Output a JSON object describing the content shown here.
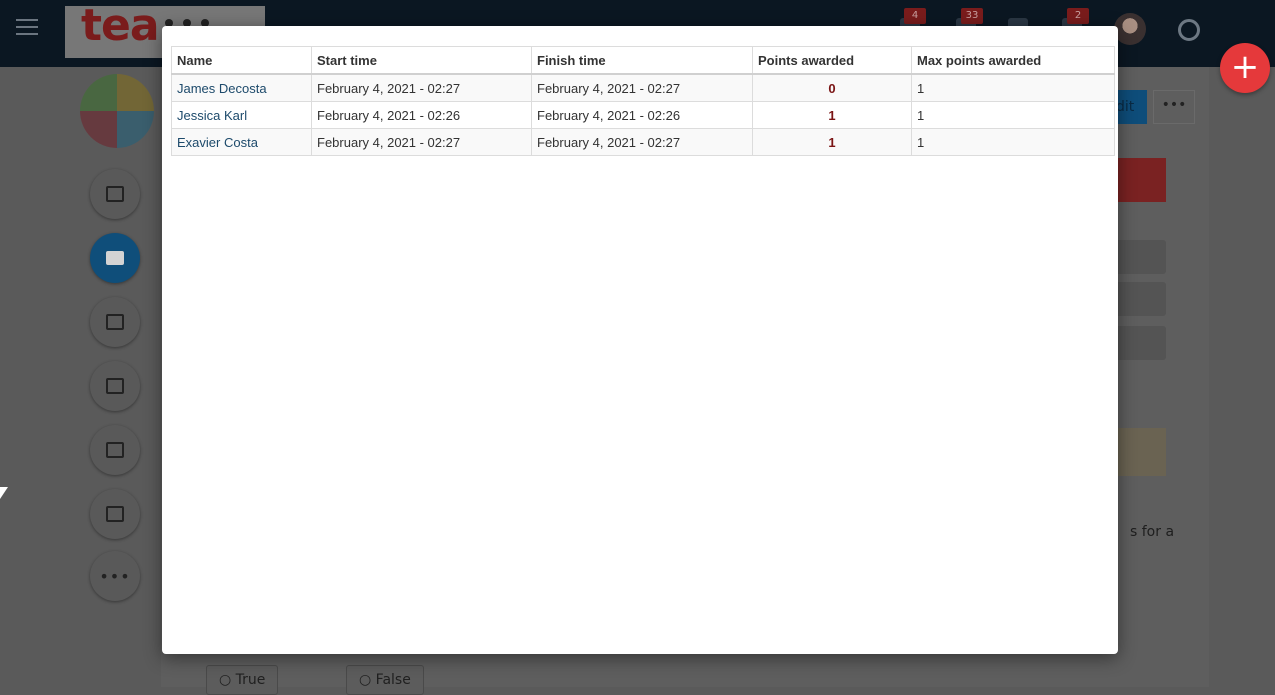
{
  "app": {
    "logo_text": "tea",
    "badges": {
      "notifications": "4",
      "messages": "33",
      "alerts": "2"
    },
    "edit_label": "dit",
    "trailing_text": "s for a",
    "answer_options": [
      "True",
      "False"
    ]
  },
  "colors": {
    "accent": "#0f4e7a",
    "fab": "#e5393b",
    "points": "#7a1414",
    "link": "#1d4a6b"
  },
  "results_table": {
    "headers": {
      "name": "Name",
      "start_time": "Start time",
      "finish_time": "Finish time",
      "points": "Points awarded",
      "max_points": "Max points awarded"
    },
    "rows": [
      {
        "name": "James Decosta",
        "start_time": "February 4, 2021 - 02:27",
        "finish_time": "February 4, 2021 - 02:27",
        "points": "0",
        "max_points": "1"
      },
      {
        "name": "Jessica Karl",
        "start_time": "February 4, 2021 - 02:26",
        "finish_time": "February 4, 2021 - 02:26",
        "points": "1",
        "max_points": "1"
      },
      {
        "name": "Exavier Costa",
        "start_time": "February 4, 2021 - 02:27",
        "finish_time": "February 4, 2021 - 02:27",
        "points": "1",
        "max_points": "1"
      }
    ]
  }
}
